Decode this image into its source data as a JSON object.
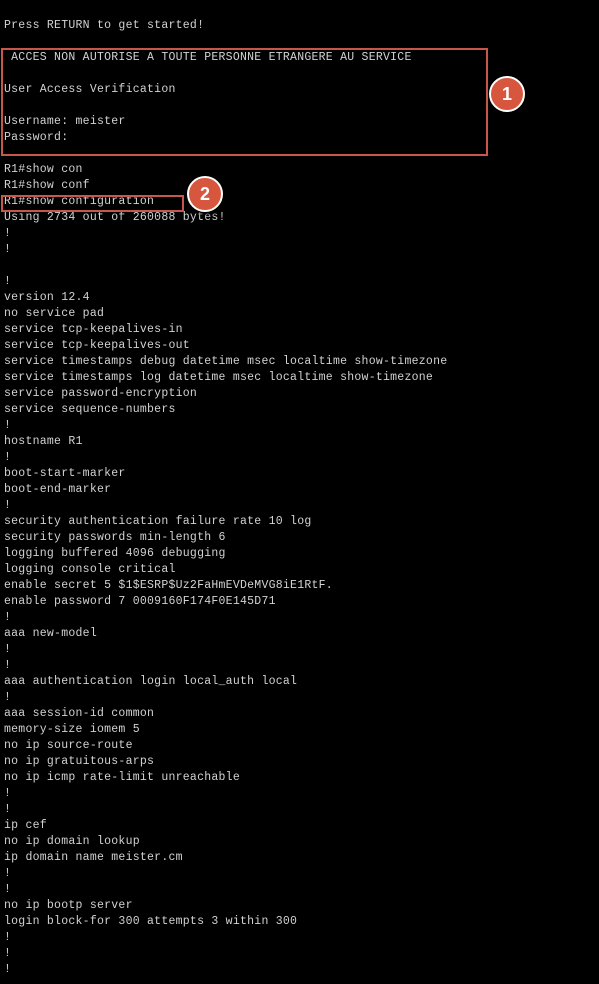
{
  "terminal": {
    "lines": [
      "Press RETURN to get started!",
      "",
      " ACCES NON AUTORISE A TOUTE PERSONNE ETRANGERE AU SERVICE",
      "",
      "User Access Verification",
      "",
      "Username: meister",
      "Password:",
      "",
      "R1#show con",
      "R1#show conf",
      "R1#show configuration",
      "Using 2734 out of 260088 bytes!",
      "!",
      "!",
      "",
      "!",
      "version 12.4",
      "no service pad",
      "service tcp-keepalives-in",
      "service tcp-keepalives-out",
      "service timestamps debug datetime msec localtime show-timezone",
      "service timestamps log datetime msec localtime show-timezone",
      "service password-encryption",
      "service sequence-numbers",
      "!",
      "hostname R1",
      "!",
      "boot-start-marker",
      "boot-end-marker",
      "!",
      "security authentication failure rate 10 log",
      "security passwords min-length 6",
      "logging buffered 4096 debugging",
      "logging console critical",
      "enable secret 5 $1$ESRP$Uz2FaHmEVDeMVG8iE1RtF.",
      "enable password 7 0009160F174F0E145D71",
      "!",
      "aaa new-model",
      "!",
      "!",
      "aaa authentication login local_auth local",
      "!",
      "aaa session-id common",
      "memory-size iomem 5",
      "no ip source-route",
      "no ip gratuitous-arps",
      "no ip icmp rate-limit unreachable",
      "!",
      "!",
      "ip cef",
      "no ip domain lookup",
      "ip domain name meister.cm",
      "!",
      "!",
      "no ip bootp server",
      "login block-for 300 attempts 3 within 300",
      "!",
      "!",
      "!"
    ]
  },
  "annotations": {
    "badge_1": "1",
    "badge_2": "2"
  },
  "colors": {
    "background": "#000000",
    "text": "#d2d2d2",
    "highlight_border": "#c8574b",
    "badge_fill": "#d6573e"
  }
}
